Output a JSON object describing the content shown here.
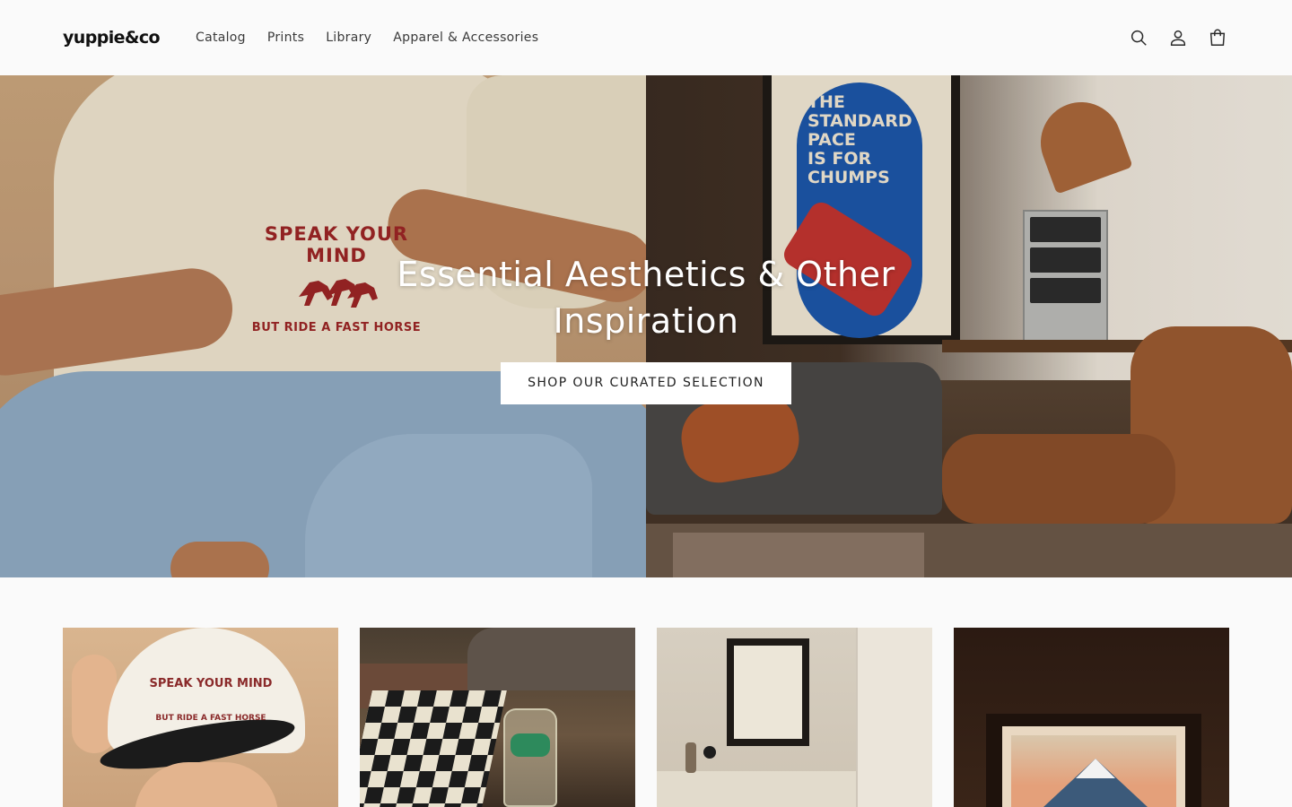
{
  "brand": {
    "logo": "yuppie&co"
  },
  "nav": {
    "items": [
      "Catalog",
      "Prints",
      "Library",
      "Apparel & Accessories"
    ]
  },
  "header_icons": {
    "search": "search-icon",
    "account": "user-icon",
    "cart": "bag-icon"
  },
  "hero": {
    "title": "Essential Aesthetics & Other Inspiration",
    "button_label": "SHOP OUR CURATED SELECTION",
    "left_image_text": {
      "arc": "SPEAK YOUR MIND",
      "sub": "BUT RIDE A FAST HORSE"
    },
    "right_image_text": [
      "THE",
      "STANDARD",
      "PACE",
      "IS FOR",
      "CHUMPS"
    ]
  },
  "products": [
    {
      "image": "cap-photo",
      "text": {
        "arc": "SPEAK YOUR MIND",
        "sub": "BUT RIDE A FAST HORSE"
      }
    },
    {
      "image": "matches-photo"
    },
    {
      "image": "gallery-frame-photo"
    },
    {
      "image": "fuji-print-photo"
    }
  ],
  "colors": {
    "accent_red": "#9b2525",
    "poster_blue": "#1c55a7",
    "background": "#fafafa"
  }
}
